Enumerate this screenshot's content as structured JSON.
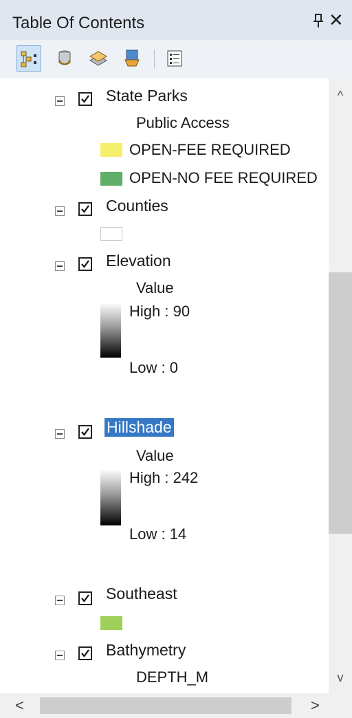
{
  "window": {
    "title": "Table Of Contents"
  },
  "toolbar": {
    "buttons": [
      {
        "icon": "list-by-drawing-order-icon",
        "active": true
      },
      {
        "icon": "list-by-source-icon"
      },
      {
        "icon": "list-by-visibility-icon"
      },
      {
        "icon": "list-by-selection-icon"
      },
      {
        "icon": "options-icon"
      }
    ]
  },
  "layers": [
    {
      "name": "State Parks",
      "checked": true,
      "legend": {
        "heading": "Public Access",
        "items": [
          {
            "label": "OPEN-FEE REQUIRED",
            "color": "#f5ef6e"
          },
          {
            "label": "OPEN-NO FEE REQUIRED",
            "color": "#5fae6a"
          }
        ]
      }
    },
    {
      "name": "Counties",
      "checked": true,
      "legend": {
        "swatch_color": "#ffffff"
      }
    },
    {
      "name": "Elevation",
      "checked": true,
      "legend": {
        "heading": "Value",
        "high": "High : 90",
        "low": "Low : 0"
      }
    },
    {
      "name": "Hillshade",
      "checked": true,
      "selected": true,
      "legend": {
        "heading": "Value",
        "high": "High : 242",
        "low": "Low : 14"
      }
    },
    {
      "name": "Southeast",
      "checked": true,
      "legend": {
        "swatch_color": "#9fd05a"
      }
    },
    {
      "name": "Bathymetry",
      "checked": true,
      "legend": {
        "heading": "DEPTH_M"
      }
    }
  ],
  "colors": {
    "selection": "#3478c6",
    "titlebar": "#dfe6f0"
  }
}
